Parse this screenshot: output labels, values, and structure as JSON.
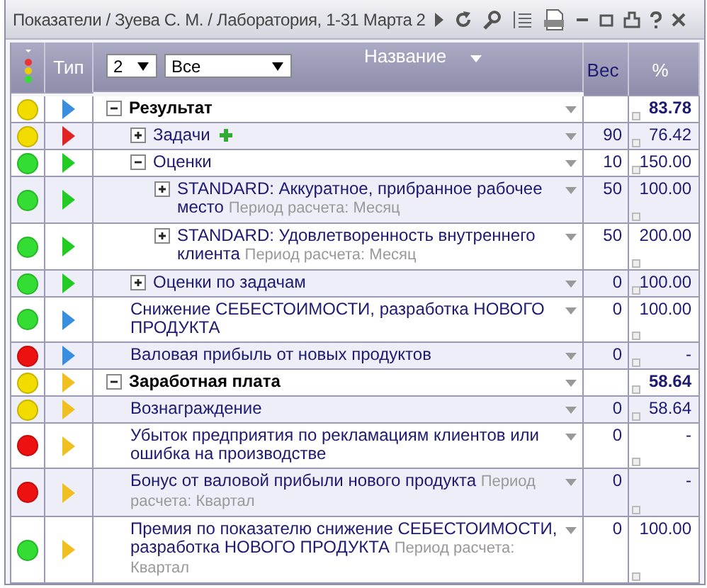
{
  "window": {
    "title": "Показатели / Зуева С. М. / Лаборатория, 1-31 Марта 2"
  },
  "header": {
    "type": "Тип",
    "name": "Название",
    "weight": "Вес",
    "percent": "%",
    "level_filter": "2",
    "status_filter": "Все"
  },
  "rows": [
    {
      "name": "Результат",
      "bold": true,
      "color": "#f2dc00",
      "kind": "blue",
      "expanded": true,
      "marker": false,
      "percent": "83.78",
      "children": [
        {
          "name": "Задачи",
          "bold": false,
          "color": "#f2dc00",
          "kind": "red",
          "expanded": false,
          "marker": true,
          "weight": "90",
          "percent": "76.42"
        },
        {
          "name": "Оценки",
          "bold": false,
          "color": "#33dd33",
          "kind": "green",
          "expanded": true,
          "marker": false,
          "weight": "10",
          "percent": "150.00",
          "children": [
            {
              "name": "STANDARD: Аккуратное, прибранное рабочее место",
              "period": "Период расчета: Месяц",
              "bold": false,
              "color": "#33dd33",
              "kind": "green",
              "expanded": false,
              "marker": false,
              "weight": "50",
              "percent": "100.00"
            },
            {
              "name": "STANDARD: Удовлетворенность внутреннего клиента",
              "period": "Период расчета: Месяц",
              "bold": false,
              "color": "#33dd33",
              "kind": "green",
              "expanded": false,
              "marker": false,
              "weight": "50",
              "percent": "200.00"
            }
          ]
        },
        {
          "name": "Оценки по задачам",
          "bold": false,
          "color": "#33dd33",
          "kind": "green",
          "expanded": false,
          "marker": false,
          "weight": "0",
          "percent": "100.00"
        },
        {
          "name": "Снижение СЕБЕСТОИМОСТИ, разработка НОВОГО ПРОДУКТА",
          "bold": false,
          "color": "#33dd33",
          "kind": "blue",
          "marker": false,
          "weight": "0",
          "percent": "100.00"
        },
        {
          "name": "Валовая прибыль от новых продуктов",
          "bold": false,
          "color": "#ee1111",
          "kind": "blue",
          "marker": false,
          "weight": "0",
          "percent": "-"
        }
      ]
    },
    {
      "name": "Заработная плата",
      "bold": true,
      "color": "#f2dc00",
      "kind": "yellow",
      "expanded": true,
      "marker": false,
      "percent": "58.64",
      "children": [
        {
          "name": "Вознаграждение",
          "bold": false,
          "color": "#f2dc00",
          "kind": "yellow",
          "marker": false,
          "weight": "0",
          "percent": "58.64"
        },
        {
          "name": "Убыток предприятия по рекламациям клиентов или ошибка на производстве",
          "bold": false,
          "color": "#ee1111",
          "kind": "yellow",
          "marker": false,
          "weight": "0",
          "percent": "-"
        },
        {
          "name": "Бонус от валовой прибыли нового продукта",
          "period": "Период расчета: Квартал",
          "bold": false,
          "color": "#ee1111",
          "kind": "yellow",
          "marker": false,
          "weight": "0",
          "percent": "-"
        },
        {
          "name": "Премия по показателю снижение СЕБЕСТОИМОСТИ, разработка НОВОГО ПРОДУКТА",
          "period": "Период расчета: Квартал",
          "bold": false,
          "color": "#33dd33",
          "kind": "yellow",
          "marker": false,
          "weight": "0",
          "percent": "100.00"
        }
      ]
    }
  ]
}
